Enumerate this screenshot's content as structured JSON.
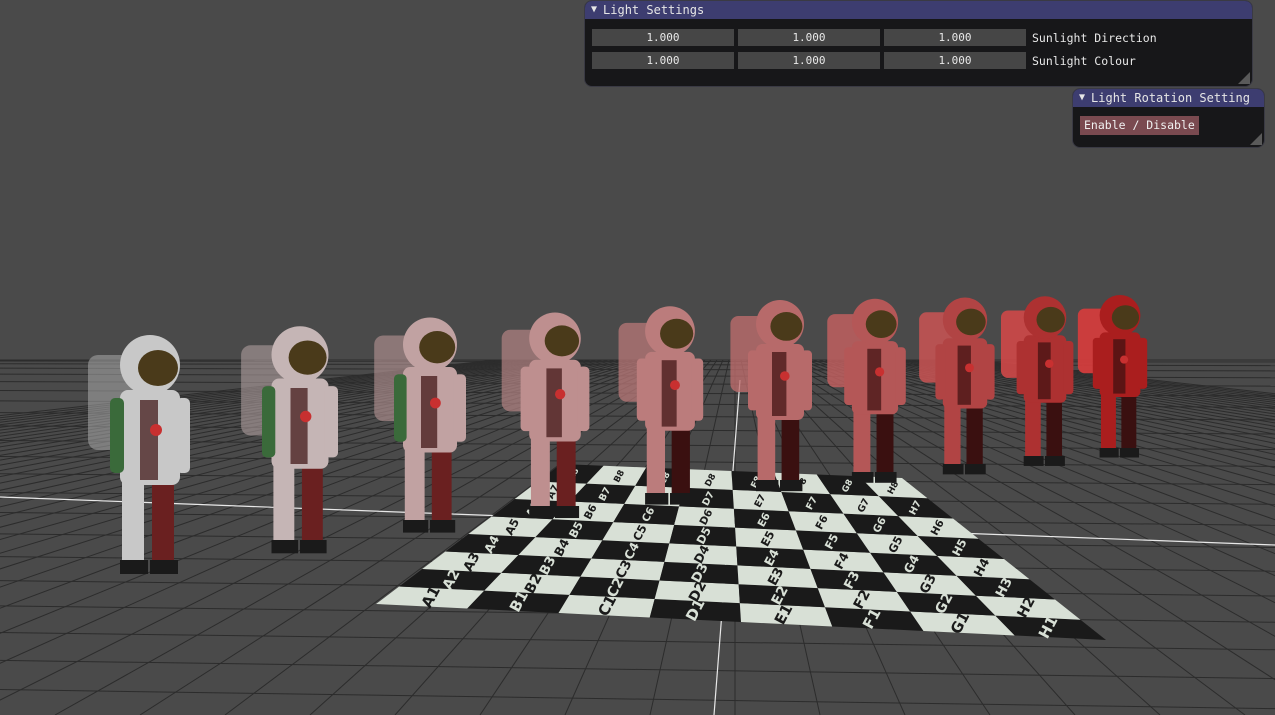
{
  "light_settings": {
    "title": "Light Settings",
    "rows": [
      {
        "values": [
          "1.000",
          "1.000",
          "1.000"
        ],
        "label": "Sunlight Direction"
      },
      {
        "values": [
          "1.000",
          "1.000",
          "1.000"
        ],
        "label": "Sunlight Colour"
      }
    ]
  },
  "rotation_setting": {
    "title": "Light Rotation Setting",
    "button_label": "Enable / Disable"
  },
  "board": {
    "files": [
      "A",
      "B",
      "C",
      "D",
      "E",
      "F",
      "G",
      "H"
    ],
    "ranks": [
      "1",
      "2",
      "3",
      "4",
      "5",
      "6",
      "7",
      "8"
    ]
  },
  "colors": {
    "background": "#4a4a4a",
    "grid": "#2c2c2c",
    "axis": "#e8e8e8",
    "title_bar": "#3d3d70",
    "button": "#7a4a50",
    "board_light": "#d8e0d6",
    "board_dark": "#1a1a1a"
  },
  "figures": {
    "count": 10,
    "subject": "astronaut"
  }
}
